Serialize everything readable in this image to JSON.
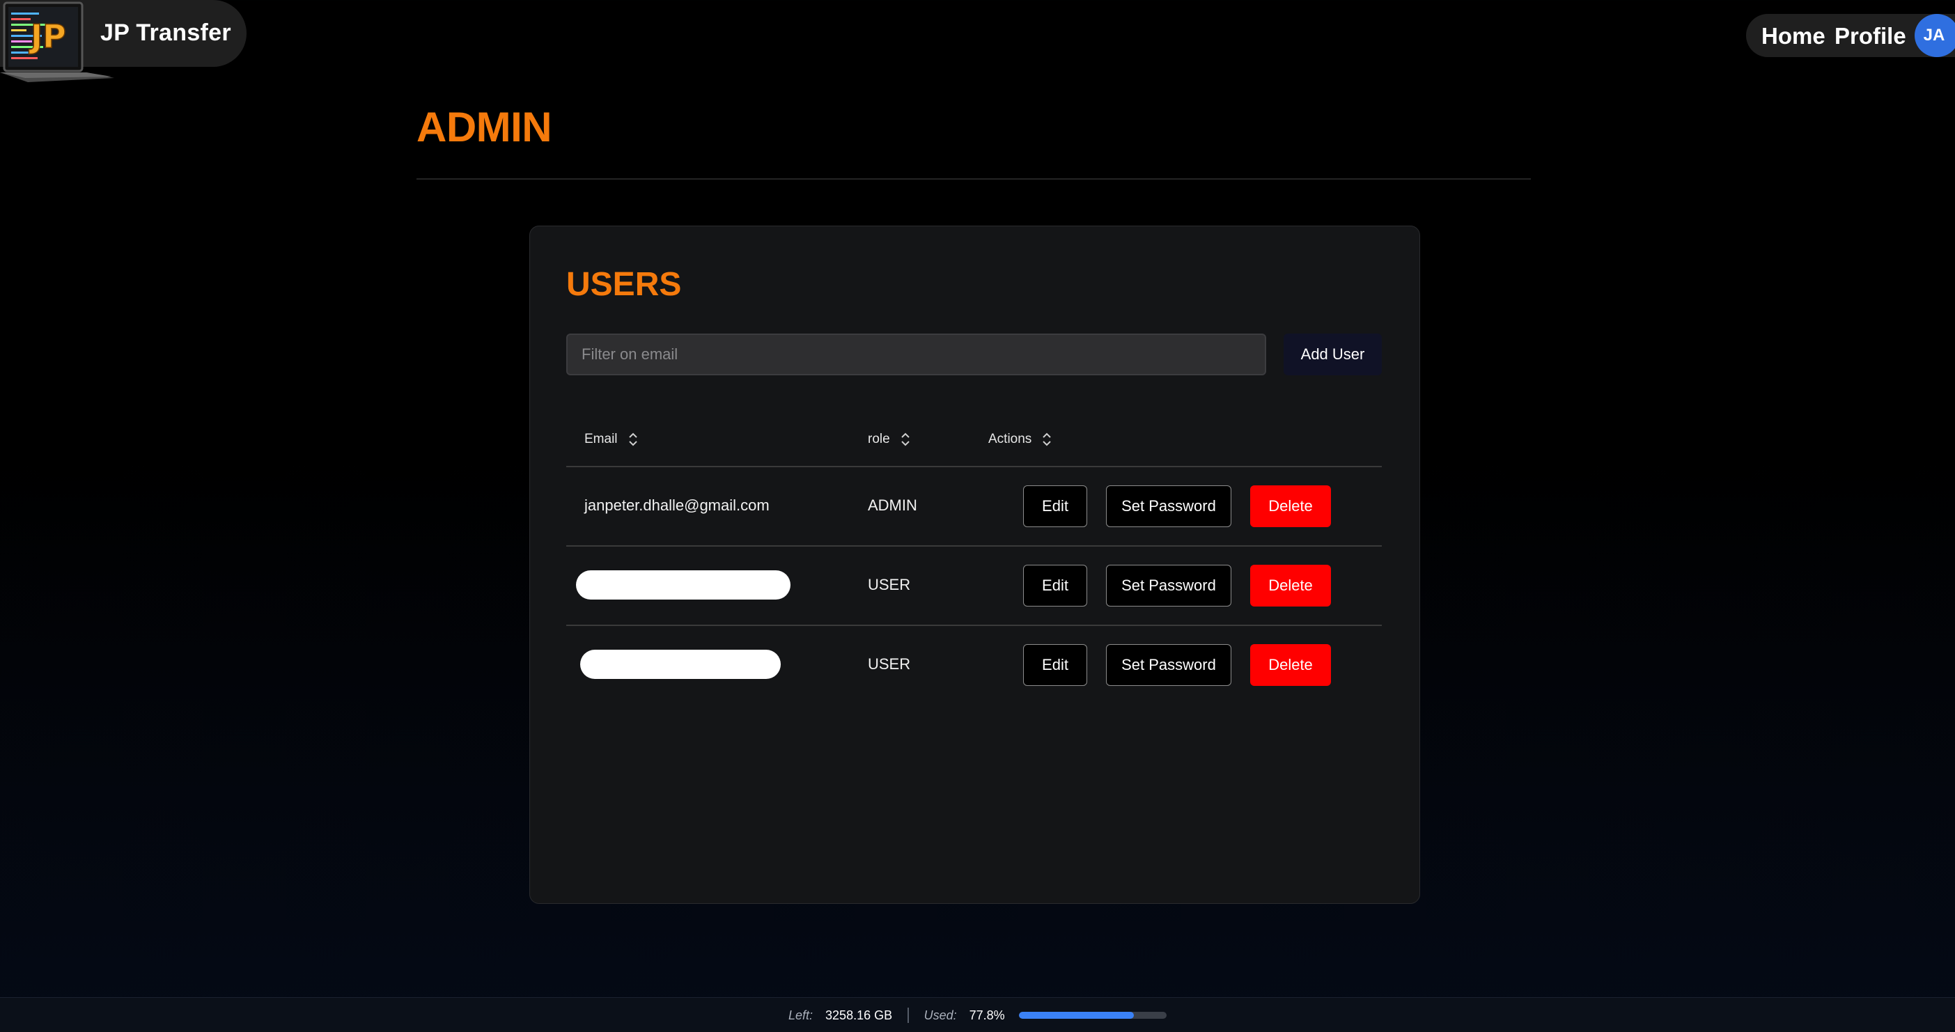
{
  "header": {
    "brand_name": "JP Transfer",
    "logo_letters": "JP",
    "nav": {
      "home": "Home",
      "profile": "Profile"
    },
    "avatar_initials": "JA"
  },
  "page": {
    "title": "ADMIN"
  },
  "users_card": {
    "title": "USERS",
    "filter_placeholder": "Filter on email",
    "add_user_label": "Add User",
    "columns": {
      "email": "Email",
      "role": "role",
      "actions": "Actions"
    },
    "rows": [
      {
        "email": "janpeter.dhalle@gmail.com",
        "role": "ADMIN",
        "redacted": false
      },
      {
        "email": "",
        "role": "USER",
        "redacted": true
      },
      {
        "email": "",
        "role": "USER",
        "redacted": true
      }
    ],
    "actions": {
      "edit": "Edit",
      "set_password": "Set Password",
      "delete": "Delete"
    }
  },
  "footer": {
    "left_label": "Left:",
    "left_value": "3258.16 GB",
    "used_label": "Used:",
    "used_value": "77.8%",
    "used_fraction": 0.778
  },
  "colors": {
    "accent": "#f57a0c",
    "danger": "#ff0000",
    "avatar": "#2f6fe0",
    "progress": "#3b82f6"
  }
}
